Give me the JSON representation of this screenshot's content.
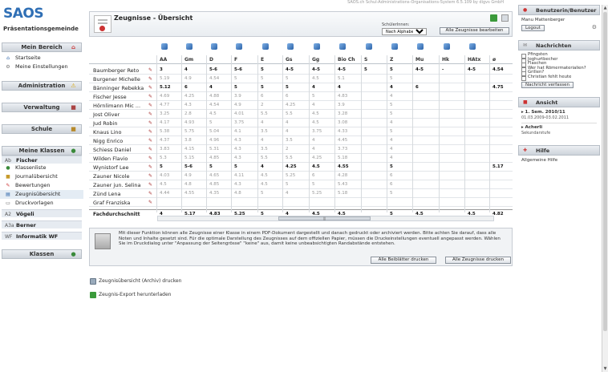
{
  "app": {
    "brand": "SAOS",
    "subtitle": "Präsentationsgemeinde",
    "window_title": "SAOS.ch Schul-Administrations-Organisations-System 6.5.109 by digvs GmbH"
  },
  "sidebar": {
    "mein_bereich": "Mein Bereich",
    "mein_items": [
      "Startseite",
      "Meine Einstellungen"
    ],
    "administration": "Administration",
    "verwaltung": "Verwaltung",
    "schule": "Schule",
    "meine_klassen": "Meine Klassen",
    "klassen": [
      {
        "code": "Ab",
        "name": "Fischer"
      },
      {
        "code": "A2",
        "name": "Vögeli"
      },
      {
        "code": "A3a",
        "name": "Berner"
      },
      {
        "code": "WF",
        "name": "Informatik WF"
      }
    ],
    "klasse_items": [
      "Klassenliste",
      "Journalübersicht",
      "Bewertungen",
      "Zeugnisübersicht",
      "Druckvorlagen"
    ],
    "klassen_bottom": "Klassen"
  },
  "main": {
    "title": "Zeugnisse - Übersicht",
    "schueler_label": "SchülerInnen:",
    "sort_value": "Nach Alphabet",
    "edit_button": "Alle Zeugnisse bearbeiten",
    "subjects": [
      "AA",
      "Gm",
      "D",
      "F",
      "E",
      "Gs",
      "Gg",
      "Bio Ch",
      "S",
      "Z",
      "Mu",
      "Hk",
      "HAtx",
      "ø"
    ],
    "students": [
      {
        "name": "Baumberger Reto",
        "bold": true,
        "g": [
          "3",
          "4",
          "5-6",
          "5-6",
          "5",
          "4-5",
          "4-5",
          "4-5",
          "5",
          "5",
          "4-5",
          "-",
          "4-5",
          "4.54"
        ]
      },
      {
        "name": "Burgener Michelle",
        "bold": false,
        "g": [
          "5.19",
          "4.9",
          "4.54",
          "5",
          "5",
          "5",
          "4.5",
          "5.1",
          "",
          "5",
          "",
          "",
          "",
          ""
        ]
      },
      {
        "name": "Bänninger Rebekka",
        "bold": true,
        "g": [
          "5.12",
          "6",
          "4",
          "5",
          "5",
          "5",
          "4",
          "4",
          "",
          "4",
          "6",
          "",
          "",
          "4.75"
        ]
      },
      {
        "name": "Fischer Jesse",
        "bold": false,
        "g": [
          "4.69",
          "4.25",
          "4.88",
          "3.9",
          "6",
          "6",
          "5",
          "4.83",
          "",
          "4",
          "",
          "",
          "",
          ""
        ]
      },
      {
        "name": "Hörnlimann Mic ...",
        "bold": false,
        "g": [
          "4.77",
          "4.3",
          "4.54",
          "4.9",
          "2",
          "4.25",
          "4",
          "3.9",
          "",
          "5",
          "",
          "",
          "",
          ""
        ]
      },
      {
        "name": "Jost Oliver",
        "bold": false,
        "g": [
          "3.25",
          "2.8",
          "4.5",
          "4.01",
          "5.5",
          "5.5",
          "4.5",
          "3.28",
          "",
          "5",
          "",
          "",
          "",
          ""
        ]
      },
      {
        "name": "Jud Robin",
        "bold": false,
        "g": [
          "4.17",
          "4.93",
          "5",
          "3.75",
          "4",
          "4",
          "4.5",
          "3.08",
          "",
          "4",
          "",
          "",
          "",
          ""
        ]
      },
      {
        "name": "Knaus Lino",
        "bold": false,
        "g": [
          "5.38",
          "5.75",
          "5.04",
          "4.1",
          "3.5",
          "4",
          "3.75",
          "4.33",
          "",
          "5",
          "",
          "",
          "",
          ""
        ]
      },
      {
        "name": "Nigg Enrico",
        "bold": false,
        "g": [
          "4.37",
          "3.8",
          "4.96",
          "4.3",
          "4",
          "3.5",
          "4",
          "4.45",
          "",
          "4",
          "",
          "",
          "",
          ""
        ]
      },
      {
        "name": "Schiess Daniel",
        "bold": false,
        "g": [
          "3.83",
          "4.15",
          "5.31",
          "4.3",
          "3.5",
          "2",
          "4",
          "3.73",
          "",
          "4",
          "",
          "",
          "",
          ""
        ]
      },
      {
        "name": "Wilden Flavio",
        "bold": false,
        "g": [
          "5.3",
          "5.15",
          "4.85",
          "4.3",
          "5.5",
          "5.5",
          "4.25",
          "5.18",
          "",
          "4",
          "",
          "",
          "",
          ""
        ]
      },
      {
        "name": "Wynistorf Lee",
        "bold": true,
        "g": [
          "5",
          "5-6",
          "5",
          "5",
          "4",
          "4.25",
          "4.5",
          "4.55",
          "",
          "5",
          "",
          "",
          "",
          "5.17"
        ]
      },
      {
        "name": "Zauner Nicole",
        "bold": false,
        "g": [
          "4.03",
          "4.9",
          "4.65",
          "4.11",
          "4.5",
          "5.25",
          "6",
          "4.28",
          "",
          "6",
          "",
          "",
          "",
          ""
        ]
      },
      {
        "name": "Zauner jun. Selina",
        "bold": false,
        "g": [
          "4.5",
          "4.8",
          "4.85",
          "4.3",
          "4.5",
          "5",
          "5",
          "5.43",
          "",
          "6",
          "",
          "",
          "",
          ""
        ]
      },
      {
        "name": "Zünd Lena",
        "bold": false,
        "g": [
          "4.44",
          "4.55",
          "4.35",
          "4.8",
          "5",
          "4",
          "5.25",
          "5.18",
          "",
          "5",
          "",
          "",
          "",
          ""
        ]
      },
      {
        "name": "Graf Franziska",
        "bold": false,
        "g": [
          "",
          "",
          "",
          "",
          "",
          "",
          "",
          "",
          "",
          "",
          "",
          "",
          "",
          ""
        ]
      }
    ],
    "average": {
      "label": "Fachdurchschnitt",
      "g": [
        "4",
        "5.17",
        "4.83",
        "5.25",
        "5",
        "4",
        "4.5",
        "4.5",
        "",
        "5",
        "4.5",
        "",
        "4.5",
        "4.82"
      ]
    },
    "info_text": "Mit dieser Funktion können alle Zeugnisse einer Klasse in einem PDF-Dokument dargestellt und danach gedruckt oder archiviert werden. Bitte achten Sie darauf, dass alle Noten und Inhalte gesetzt sind. Für die optimale Darstellung des Zeugnisses auf dem offiziellen Papier, müssen die Druckeinstellungen eventuell angepasst werden. Wählen Sie im Druckdialog unter \"Anpassung der Seitengrösse\" \"keine\" aus, damit keine unbeabsichtigten Randabstände entstehen.",
    "btn_beiblaetter": "Alle Beiblätter drucken",
    "btn_zeugnisse": "Alle Zeugnisse drucken",
    "link_archiv": "Zeugnisübersicht (Archiv) drucken",
    "link_export": "Zeugnis-Export herunterladen"
  },
  "right": {
    "benutzer_title": "Benutzerin/Benutzer",
    "user": "Manu Mattenberger",
    "logout": "Logout",
    "nachrichten_title": "Nachrichten",
    "nachrichten": [
      "Pfingsten",
      "Joghurtbecher",
      "Flaschen",
      "Wer hat Römermaterialien?",
      "Grillen?",
      "Christian fehlt heute"
    ],
    "nachricht_btn": "Nachricht verfassen",
    "ansicht_title": "Ansicht",
    "semester": "1. Sem. 2010/11",
    "semester_dates": "01.03.2009-03.02.2011",
    "schule": "Acherli",
    "stufe": "Sekundarstufe",
    "hilfe_title": "Hilfe",
    "hilfe_text": "Allgemeine Hilfe"
  },
  "colors": {
    "accent": "#2f6fb5",
    "header_grad": "#cdd3da"
  }
}
